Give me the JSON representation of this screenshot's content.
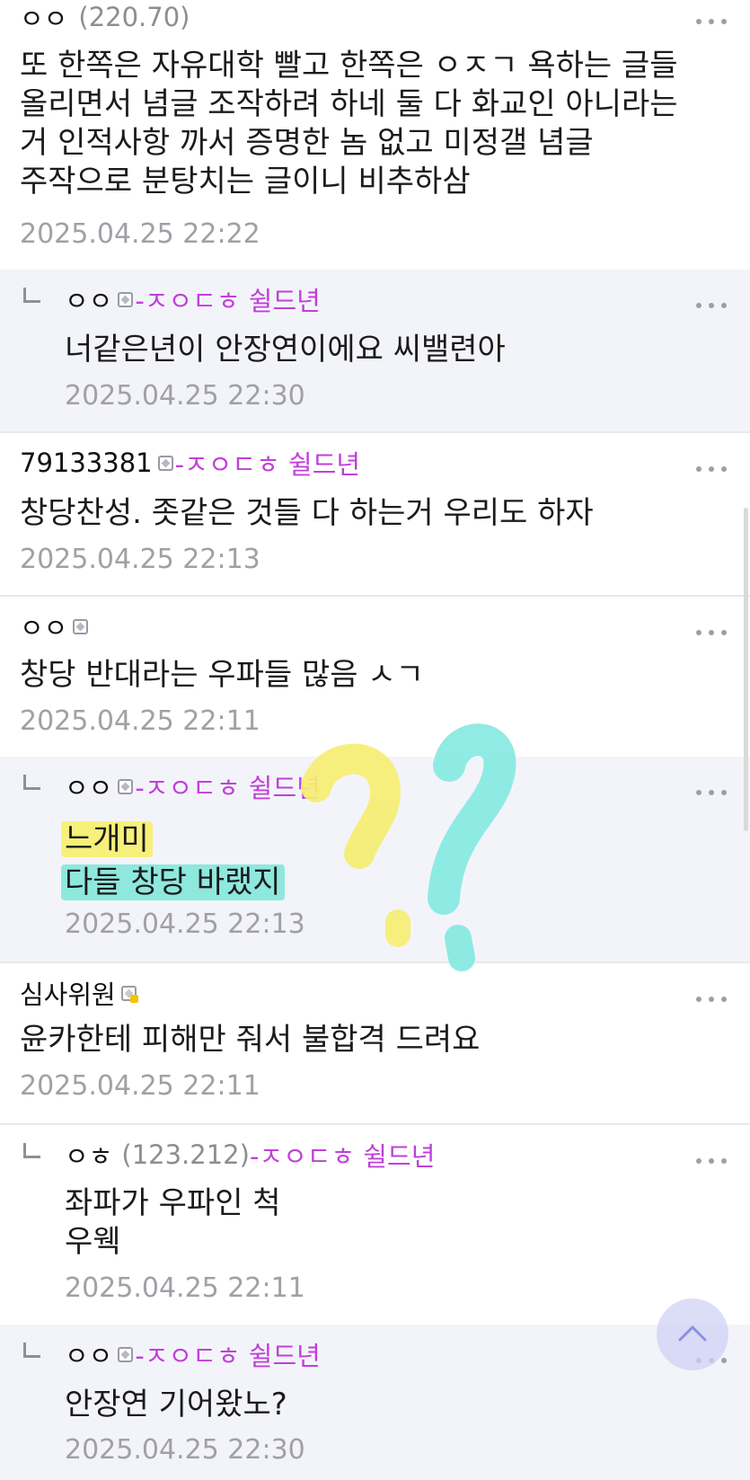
{
  "comments": [
    {
      "nick": "ㅇㅇ",
      "ip": "(220.70)",
      "text_lines": [
        "또 한쪽은 자유대학 빨고 한쪽은 ㅇㅈㄱ 욕하는 글들",
        "올리면서 념글 조작하려 하네 둘 다 화교인 아니라는",
        "거 인적사항 까서 증명한 놈 없고 미정갤 념글",
        "주작으로 분탕치는 글이니 비추하삼"
      ],
      "date": "2025.04.25 22:22"
    },
    {
      "nick": "ㅇㅇ",
      "tag": "-ㅈㅇㄷㅎ 쉴드년",
      "text_lines": [
        "너같은년이 안장연이에요 씨밸련아"
      ],
      "date": "2025.04.25 22:30"
    },
    {
      "nick": "79133381",
      "tag": "-ㅈㅇㄷㅎ 쉴드년",
      "text_lines": [
        "창당찬성. 좃같은 것들 다 하는거 우리도 하자"
      ],
      "date": "2025.04.25 22:13"
    },
    {
      "nick": "ㅇㅇ",
      "text_lines": [
        "창당 반대라는 우파들 많음 ㅅㄱ"
      ],
      "date": "2025.04.25 22:11"
    },
    {
      "nick": "ㅇㅇ",
      "tag": "-ㅈㅇㄷㅎ 쉴드년",
      "text_lines": [
        "느개미",
        "다들 창당 바랬지"
      ],
      "date": "2025.04.25 22:13"
    },
    {
      "nick": "심사위원",
      "text_lines": [
        "윤카한테 피해만 줘서 불합격 드려요"
      ],
      "date": "2025.04.25 22:11"
    },
    {
      "nick": "ㅇㅎ",
      "ip": "(123.212)",
      "tag": "-ㅈㅇㄷㅎ 쉴드년",
      "text_lines": [
        "좌파가 우파인 척",
        "우웩"
      ],
      "date": "2025.04.25 22:11"
    },
    {
      "nick": "ㅇㅇ",
      "tag": "-ㅈㅇㄷㅎ 쉴드년",
      "text_lines": [
        "안장연 기어왔노?"
      ],
      "date": "2025.04.25 22:30"
    }
  ],
  "colors": {
    "tag": "#c040d8",
    "reply_bg": "#f3f4fa",
    "highlight_yellow": "#f7f07a",
    "highlight_cyan": "#8ee8de"
  },
  "icons": {
    "more": "more-dots-icon",
    "reply": "reply-arrow-icon",
    "fixed_nick": "fixed-nick-icon",
    "scroll_top": "chevron-up-icon"
  }
}
